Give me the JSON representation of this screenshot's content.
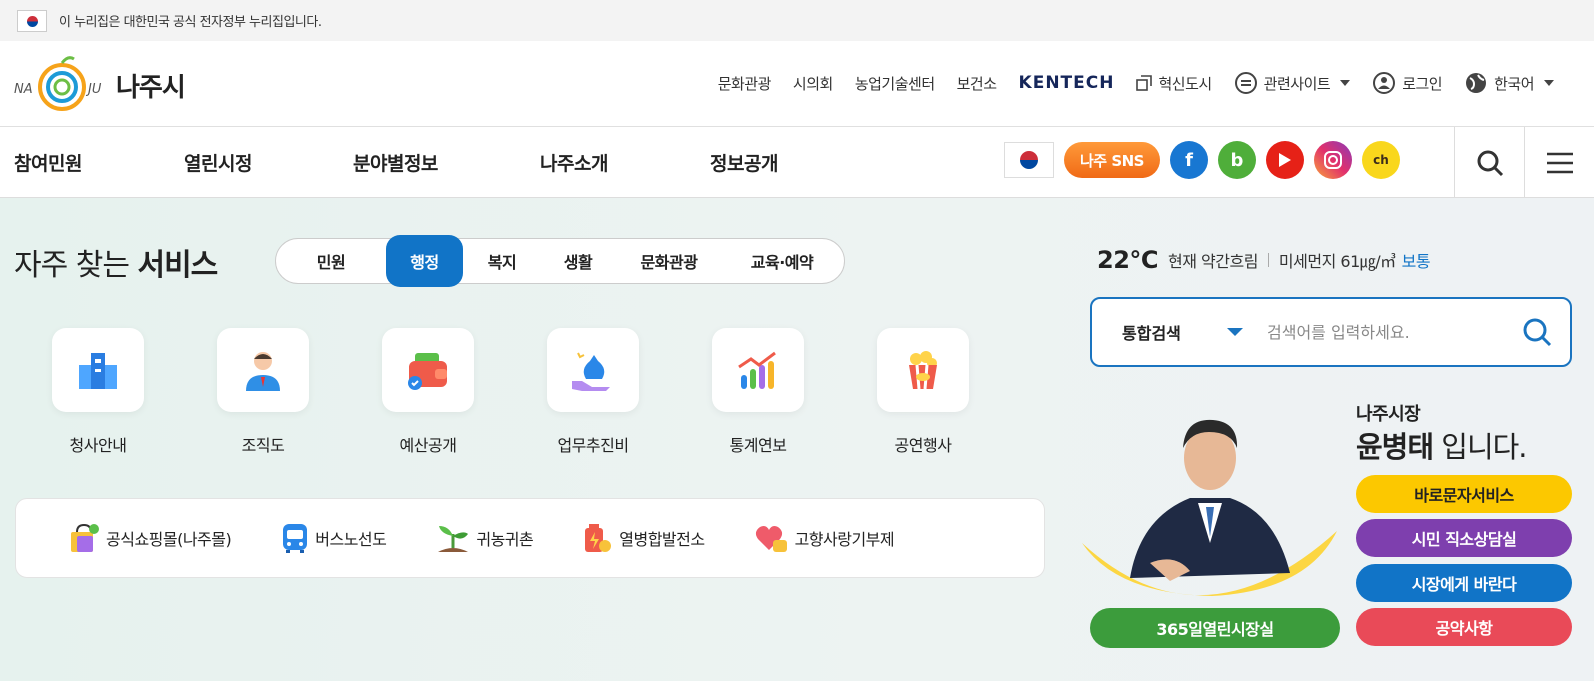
{
  "gov_banner": {
    "text": "이 누리집은 대한민국 공식 전자정부 누리집입니다."
  },
  "logo": {
    "name": "나주시",
    "mark_left": "NA",
    "mark_right": "JU"
  },
  "utility_links": [
    "문화관광",
    "시의회",
    "농업기술센터",
    "보건소"
  ],
  "utility": {
    "kentech": "KENTECH",
    "innovation_city": "혁신도시",
    "related_sites": "관련사이트",
    "login": "로그인",
    "language": "한국어"
  },
  "gnb": [
    "참여민원",
    "열린시정",
    "분야별정보",
    "나주소개",
    "정보공개"
  ],
  "sns": {
    "label": "나주 SNS",
    "facebook": "f",
    "blog": "b",
    "chat": "ch"
  },
  "services": {
    "title_light": "자주 찾는 ",
    "title_bold": "서비스",
    "tabs": [
      "민원",
      "행정",
      "복지",
      "생활",
      "문화관광",
      "교육·예약"
    ],
    "active_tab": "행정",
    "tiles": [
      "청사안내",
      "조직도",
      "예산공개",
      "업무추진비",
      "통계연보",
      "공연행사"
    ]
  },
  "quick_links": [
    "공식쇼핑몰(나주몰)",
    "버스노선도",
    "귀농귀촌",
    "열병합발전소",
    "고향사랑기부제"
  ],
  "weather": {
    "temp": "22°C",
    "desc": "현재 약간흐림",
    "dust": "미세먼지 61㎍/㎥",
    "level": "보통"
  },
  "search": {
    "category": "통합검색",
    "placeholder": "검색어를 입력하세요."
  },
  "mayor": {
    "title": "나주시장",
    "name": "윤병태",
    "suffix": " 입니다.",
    "buttons": [
      "바로문자서비스",
      "시민 직소상담실",
      "시장에게 바란다",
      "공약사항"
    ],
    "open_office": "365일열린시장실"
  },
  "colors": {
    "accent": "#1174c7",
    "sns_orange": "#f47a20",
    "yellow": "#fcc800",
    "purple": "#7e3fae",
    "blue": "#1174c7",
    "red": "#e94a58",
    "green": "#3c9c3c"
  }
}
